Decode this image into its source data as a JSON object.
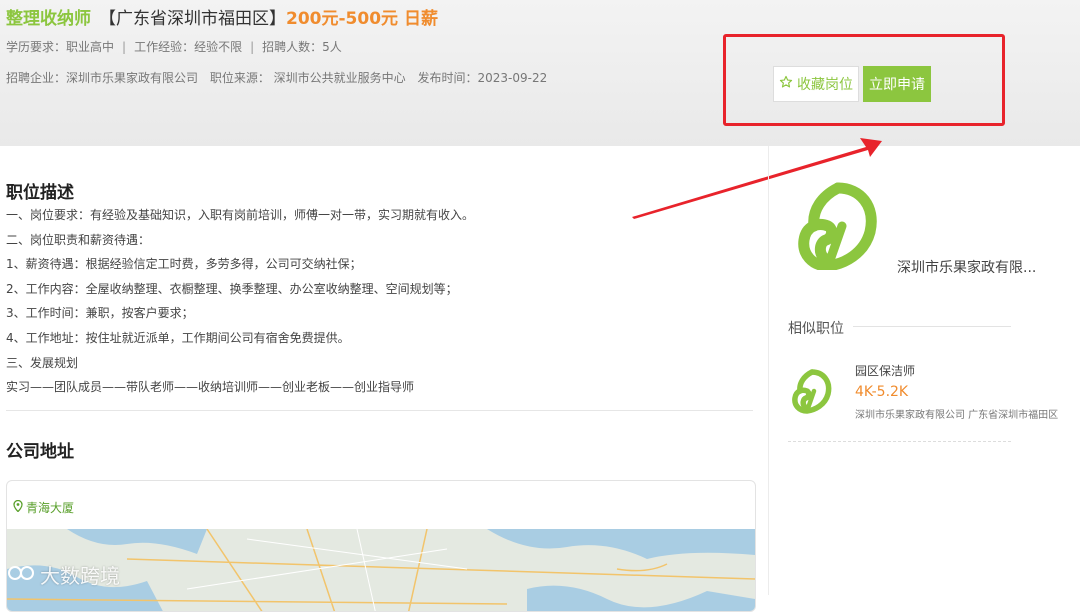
{
  "job": {
    "title": "整理收纳师",
    "location": "【广东省深圳市福田区】",
    "salary": "200元-500元 日薪",
    "education": "学历要求：职业高中",
    "experience": "工作经验：经验不限",
    "headcount": "招聘人数：5人",
    "company": "招聘企业：深圳市乐果家政有限公司",
    "source": "职位来源： 深圳市公共就业服务中心",
    "published": "发布时间：2023-09-22"
  },
  "actions": {
    "favorite_label": "收藏岗位",
    "apply_label": "立即申请"
  },
  "description": {
    "heading": "职位描述",
    "lines": [
      "一、岗位要求：有经验及基础知识，入职有岗前培训，师傅一对一带，实习期就有收入。",
      "二、岗位职责和薪资待遇：",
      "1、薪资待遇：根据经验信定工时费，多劳多得，公司可交纳社保；",
      "2、工作内容：全屋收纳整理、衣橱整理、换季整理、办公室收纳整理、空间规划等；",
      "3、工作时间：兼职，按客户要求；",
      "4、工作地址：按住址就近派单，工作期间公司有宿舍免费提供。",
      "三、发展规划",
      "实习——团队成员——带队老师——收纳培训师——创业老板——创业指导师"
    ]
  },
  "address": {
    "heading": "公司地址",
    "place": "青海大厦"
  },
  "sidebar": {
    "company_name": "深圳市乐果家政有限...",
    "similar_heading": "相似职位",
    "similar": [
      {
        "title": "园区保洁师",
        "salary": "4K-5.2K",
        "company": "深圳市乐果家政有限公司 广东省深圳市福田区"
      }
    ]
  },
  "watermark": "大数跨境",
  "colors": {
    "brand_green": "#8cc63f",
    "salary_orange": "#f08c2e",
    "annotation_red": "#e8232b"
  },
  "icons": {
    "favorite": "star-outline-icon",
    "location": "map-pin-icon",
    "logo": "leaf-logo"
  }
}
